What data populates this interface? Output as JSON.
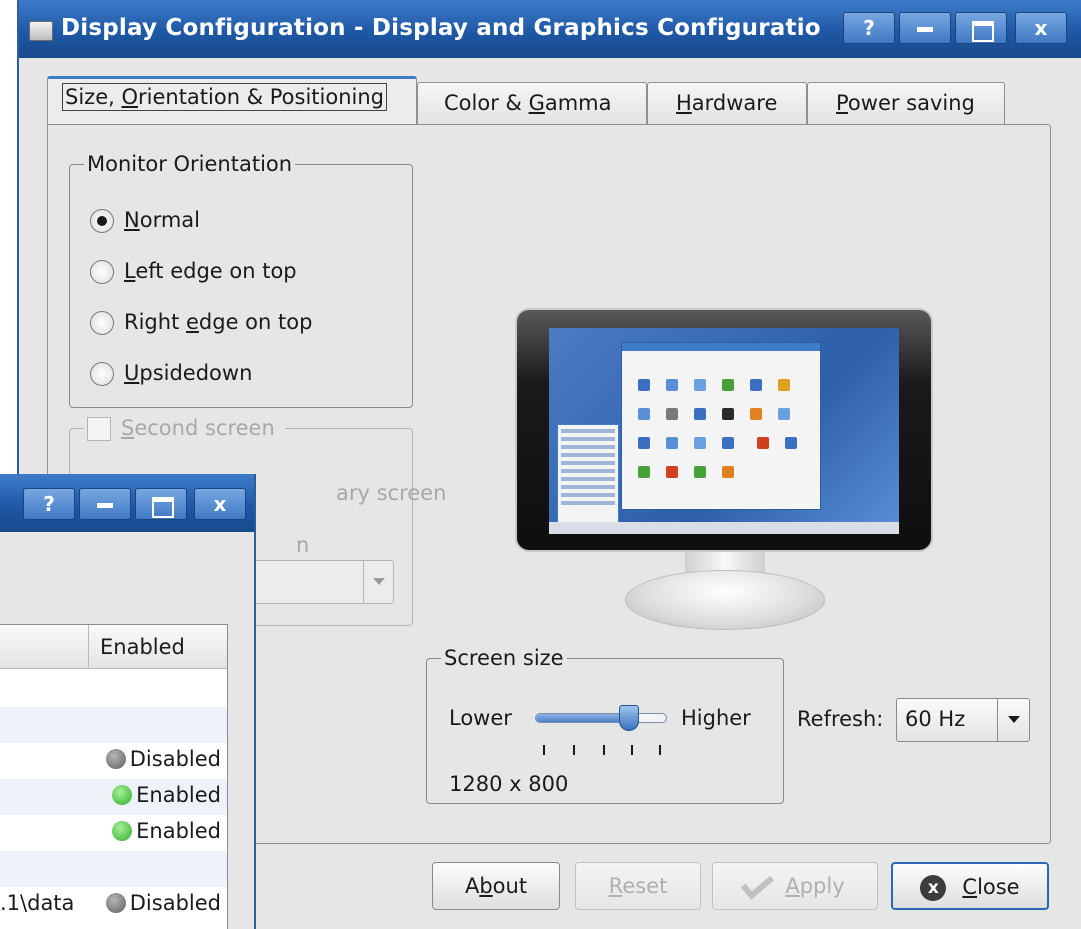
{
  "main_window": {
    "title": "Display Configuration - Display and Graphics Configuratio",
    "titlebar_buttons": {
      "help": "?",
      "close": "x"
    }
  },
  "tabs": [
    {
      "pre": "Size, ",
      "key": "O",
      "post": "rientation & Positioning"
    },
    {
      "pre": "Color & ",
      "key": "G",
      "post": "amma"
    },
    {
      "pre": "",
      "key": "H",
      "post": "ardware"
    },
    {
      "pre": "",
      "key": "P",
      "post": "ower saving"
    }
  ],
  "orientation": {
    "legend": "Monitor Orientation",
    "options": [
      {
        "key": "N",
        "rest": "ormal",
        "pre": "",
        "checked": true
      },
      {
        "key": "L",
        "rest": "eft edge on top",
        "pre": "",
        "checked": false
      },
      {
        "pre": "Right ",
        "key": "e",
        "rest": "dge on top",
        "checked": false
      },
      {
        "key": "U",
        "rest": "psidedown",
        "pre": "",
        "checked": false
      }
    ]
  },
  "second_screen": {
    "key": "S",
    "rest": "econd screen",
    "clone_partial": "ary screen",
    "other_partial": "n"
  },
  "screen_size": {
    "legend": "Screen size",
    "lower": "Lower",
    "higher": "Higher",
    "resolution": "1280 x 800",
    "slider_fraction": 0.75
  },
  "refresh": {
    "label": "Refresh:",
    "value": "60 Hz"
  },
  "buttons": {
    "about_pre": "A",
    "about_key": "b",
    "about_post": "out",
    "reset_key": "R",
    "reset_post": "eset",
    "apply_key": "A",
    "apply_post": "pply",
    "close_icon": "x",
    "close_key": "C",
    "close_post": "lose"
  },
  "second_window": {
    "titlebar_buttons": {
      "help": "?",
      "close": "x"
    },
    "column_header": "Enabled",
    "rows": [
      {
        "path": "",
        "status": "",
        "dot": ""
      },
      {
        "path": "",
        "status": "",
        "dot": ""
      },
      {
        "path": "",
        "status": "Disabled",
        "dot": "gray"
      },
      {
        "path": "",
        "status": "Enabled",
        "dot": "green"
      },
      {
        "path": "",
        "status": "Enabled",
        "dot": "green"
      },
      {
        "path": "",
        "status": "",
        "dot": ""
      },
      {
        "path": ".1\\data",
        "status": "Disabled",
        "dot": "gray"
      }
    ]
  },
  "colors": {
    "titlebar": "#1f58a6",
    "window_bg": "#e6e6e6",
    "status_enabled": "#2fae29",
    "status_disabled": "#5f5f5f"
  }
}
